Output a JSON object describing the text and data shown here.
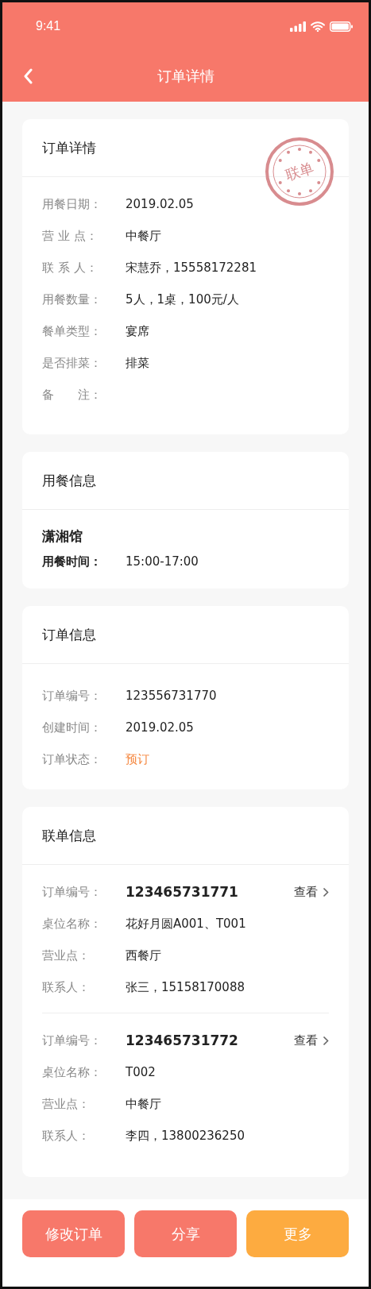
{
  "status_bar": {
    "time": "9:41"
  },
  "nav": {
    "title": "订单详情"
  },
  "order_details": {
    "title": "订单详情",
    "stamp": "联单",
    "rows": [
      {
        "label": "用餐日期：",
        "value": "2019.02.05"
      },
      {
        "label": "营 业 点：",
        "value": "中餐厅"
      },
      {
        "label": "联 系 人：",
        "value": "宋慧乔，15558172281"
      },
      {
        "label": "用餐数量：",
        "value": "5人，1桌，100元/人"
      },
      {
        "label": "餐单类型：",
        "value": "宴席"
      },
      {
        "label": "是否排菜：",
        "value": "排菜"
      },
      {
        "label": "备　　注："
      }
    ]
  },
  "dining_info": {
    "title": "用餐信息",
    "venue": "潇湘馆",
    "time_label": "用餐时间：",
    "time_value": "15:00-17:00"
  },
  "order_info": {
    "title": "订单信息",
    "rows": [
      {
        "label": "订单编号：",
        "value": "123556731770",
        "kind": "plain"
      },
      {
        "label": "创建时间：",
        "value": "2019.02.05",
        "kind": "plain"
      },
      {
        "label": "订单状态：",
        "value": "预订",
        "kind": "status"
      }
    ]
  },
  "linked_orders": {
    "title": "联单信息",
    "orders": [
      {
        "number_label": "订单编号：",
        "number": "123465731771",
        "view": "查看",
        "rows": [
          {
            "label": "桌位名称：",
            "value": "花好月圆A001、T001"
          },
          {
            "label": "营业点：",
            "value": "西餐厅"
          },
          {
            "label": "联系人：",
            "value": "张三，15158170088"
          }
        ]
      },
      {
        "number_label": "订单编号：",
        "number": "123465731772",
        "view": "查看",
        "rows": [
          {
            "label": "桌位名称：",
            "value": "T002"
          },
          {
            "label": "营业点：",
            "value": "中餐厅"
          },
          {
            "label": "联系人：",
            "value": "李四，13800236250"
          }
        ]
      }
    ]
  },
  "buttons": [
    {
      "label": "修改订单",
      "color": "#f7786a"
    },
    {
      "label": "分享",
      "color": "#f7786a"
    },
    {
      "label": "更多",
      "color": "#fdab40"
    }
  ]
}
